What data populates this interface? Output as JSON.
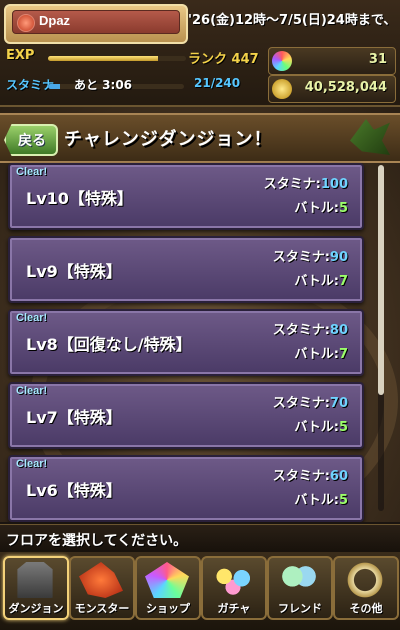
{
  "header": {
    "player_name": "Dpaz",
    "event_text": "'26(金)12時～7/5(日)24時まで、",
    "exp_label": "EXP",
    "exp_progress": 0.8,
    "rank_text": "ランク 447",
    "stamina_label": "スタミナ",
    "stamina_timer": "あと 3:06",
    "stamina_value": "21/240",
    "stamina_progress": 0.0875,
    "magic_stones": "31",
    "coins": "40,528,044"
  },
  "page": {
    "back_label": "戻る",
    "title": "チャレンジダンジョン！"
  },
  "dungeons": [
    {
      "clear": "Clear!",
      "name": "Lv10【特殊】",
      "stamina_label": "スタミナ:",
      "stamina": "100",
      "battle_label": "バトル:",
      "battles": "5"
    },
    {
      "clear": "",
      "name": "Lv9【特殊】",
      "stamina_label": "スタミナ:",
      "stamina": "90",
      "battle_label": "バトル:",
      "battles": "7"
    },
    {
      "clear": "Clear!",
      "name": "Lv8【回復なし/特殊】",
      "stamina_label": "スタミナ:",
      "stamina": "80",
      "battle_label": "バトル:",
      "battles": "7"
    },
    {
      "clear": "Clear!",
      "name": "Lv7【特殊】",
      "stamina_label": "スタミナ:",
      "stamina": "70",
      "battle_label": "バトル:",
      "battles": "5"
    },
    {
      "clear": "Clear!",
      "name": "Lv6【特殊】",
      "stamina_label": "スタミナ:",
      "stamina": "60",
      "battle_label": "バトル:",
      "battles": "5"
    }
  ],
  "instruction": "フロアを選択してください。",
  "nav": [
    {
      "label": "ダンジョン",
      "icon": "dungeon-gate-icon",
      "active": true
    },
    {
      "label": "モンスター",
      "icon": "monster-icon",
      "active": false
    },
    {
      "label": "ショップ",
      "icon": "shop-gem-icon",
      "active": false
    },
    {
      "label": "ガチャ",
      "icon": "gacha-egg-icon",
      "active": false
    },
    {
      "label": "フレンド",
      "icon": "friend-icon",
      "active": false
    },
    {
      "label": "その他",
      "icon": "other-ring-icon",
      "active": false
    }
  ]
}
